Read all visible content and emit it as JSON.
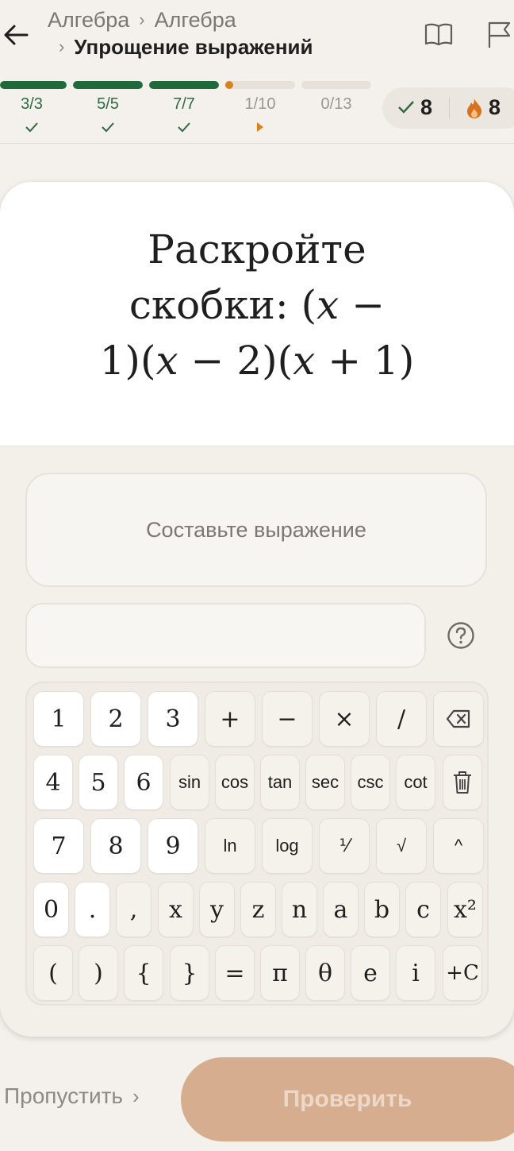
{
  "header": {
    "back_label": "←",
    "breadcrumb": [
      "Алгебра",
      "Алгебра"
    ],
    "current": "Упрощение выражений",
    "sep": "›"
  },
  "progress": {
    "segments": [
      {
        "label": "3/3",
        "fill": 1.0,
        "state": "done"
      },
      {
        "label": "5/5",
        "fill": 1.0,
        "state": "done"
      },
      {
        "label": "7/7",
        "fill": 1.0,
        "state": "done"
      },
      {
        "label": "1/10",
        "fill": 0.1,
        "state": "current"
      },
      {
        "label": "0/13",
        "fill": 0.0,
        "state": "todo"
      }
    ],
    "colors": {
      "done": "#1e6a3a",
      "current": "#d9821f",
      "track": "#e6e2da"
    }
  },
  "stats": {
    "correct": "8",
    "streak": "8"
  },
  "question": {
    "line1": "Раскройте",
    "line2_text": "скобки: ",
    "line2_math": [
      "(",
      "x",
      " −"
    ],
    "line3_math": [
      "1)(",
      "x",
      " − 2)(",
      "x",
      " + 1)"
    ]
  },
  "compose": {
    "placeholder": "Составьте выражение"
  },
  "keypad": {
    "rows": [
      [
        "1",
        "2",
        "3",
        "+",
        "−",
        "×",
        "/",
        "⌫"
      ],
      [
        "4",
        "5",
        "6",
        "sin",
        "cos",
        "tan",
        "sec",
        "csc",
        "cot",
        "🗑"
      ],
      [
        "7",
        "8",
        "9",
        "ln",
        "log",
        "⅟",
        "√",
        "^"
      ],
      [
        "0",
        ".",
        ",",
        "x",
        "y",
        "z",
        "n",
        "a",
        "b",
        "c",
        "x²"
      ],
      [
        "(",
        ")",
        "{",
        "}",
        "=",
        "π",
        "θ",
        "e",
        "i",
        "+C"
      ]
    ]
  },
  "footer": {
    "skip": "Пропустить",
    "skip_arrow": "›",
    "check": "Проверить"
  }
}
